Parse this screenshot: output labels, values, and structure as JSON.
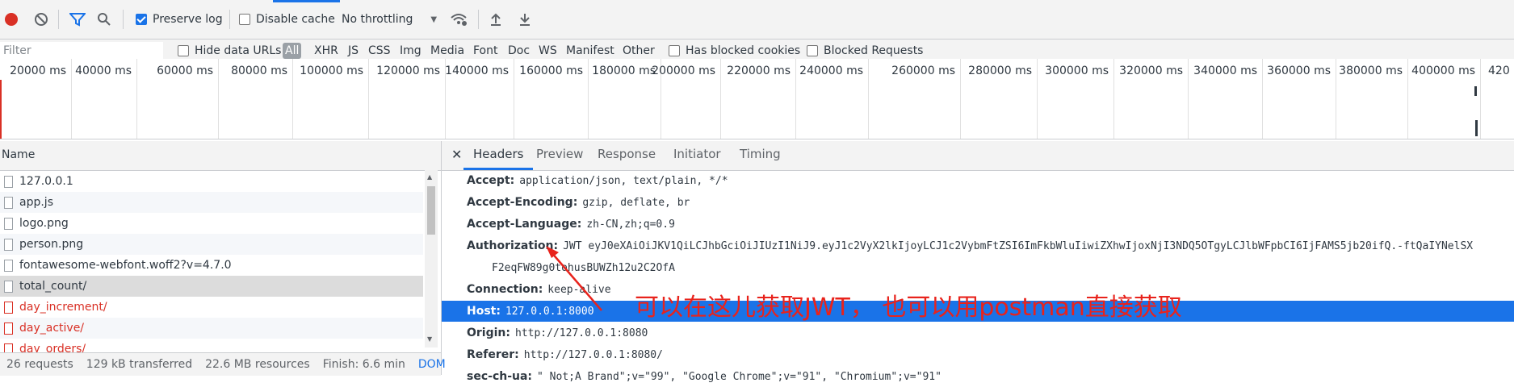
{
  "toolbar": {
    "preserve_log_label": "Preserve log",
    "preserve_log_checked": true,
    "disable_cache_label": "Disable cache",
    "disable_cache_checked": false,
    "throttling_value": "No throttling",
    "icons": [
      "record-icon",
      "clear-icon",
      "filter-icon",
      "search-icon",
      "chevron-down-icon",
      "network-conditions-icon",
      "import-icon",
      "export-icon"
    ],
    "record_color": "#d93025",
    "filter_color": "#1a73e8"
  },
  "filterbar": {
    "filter_placeholder": "Filter",
    "hide_data_urls_label": "Hide data URLs",
    "types": [
      "All",
      "XHR",
      "JS",
      "CSS",
      "Img",
      "Media",
      "Font",
      "Doc",
      "WS",
      "Manifest",
      "Other"
    ],
    "has_blocked_cookies_label": "Has blocked cookies",
    "blocked_requests_label": "Blocked Requests"
  },
  "overview": {
    "ticks": [
      "20000 ms",
      "40000 ms",
      "60000 ms",
      "80000 ms",
      "100000 ms",
      "120000 ms",
      "140000 ms",
      "160000 ms",
      "180000 ms",
      "200000 ms",
      "220000 ms",
      "240000 ms",
      "260000 ms",
      "280000 ms",
      "300000 ms",
      "320000 ms",
      "340000 ms",
      "360000 ms",
      "380000 ms",
      "400000 ms",
      "420"
    ]
  },
  "requests": {
    "header": "Name",
    "items": [
      {
        "name": "127.0.0.1",
        "error": false
      },
      {
        "name": "app.js",
        "error": false
      },
      {
        "name": "logo.png",
        "error": false
      },
      {
        "name": "person.png",
        "error": false
      },
      {
        "name": "fontawesome-webfont.woff2?v=4.7.0",
        "error": false
      },
      {
        "name": "total_count/",
        "error": false
      },
      {
        "name": "day_increment/",
        "error": true
      },
      {
        "name": "day_active/",
        "error": true
      },
      {
        "name": "day_orders/",
        "error": true
      }
    ]
  },
  "statusbar": {
    "requests": "26 requests",
    "transferred": "129 kB transferred",
    "resources": "22.6 MB resources",
    "finish": "Finish: 6.6 min",
    "dom": "DOM"
  },
  "details": {
    "tabs": [
      "Headers",
      "Preview",
      "Response",
      "Initiator",
      "Timing"
    ],
    "active_tab": "Headers",
    "headers": [
      {
        "key": "Accept:",
        "value": "application/json, text/plain, */*"
      },
      {
        "key": "Accept-Encoding:",
        "value": "gzip, deflate, br"
      },
      {
        "key": "Accept-Language:",
        "value": "zh-CN,zh;q=0.9"
      },
      {
        "key": "Authorization:",
        "value": "JWT eyJ0eXAiOiJKV1QiLCJhbGciOiJIUzI1NiJ9.eyJ1c2VyX2lkIjoyLCJ1c2VybmFtZSI6ImFkbWluIiwiZXhwIjoxNjI3NDQ5OTgyLCJlbWFpbCI6IjFAMS5jb20ifQ.-ftQaIYNelSX"
      },
      {
        "key": "",
        "value": "F2eqFW89g0tohusBUWZh12u2C2OfA"
      },
      {
        "key": "Connection:",
        "value": "keep-alive"
      },
      {
        "key": "Host:",
        "value": "127.0.0.1:8000"
      },
      {
        "key": "Origin:",
        "value": "http://127.0.0.1:8080"
      },
      {
        "key": "Referer:",
        "value": "http://127.0.0.1:8080/"
      },
      {
        "key": "sec-ch-ua:",
        "value": "\" Not;A Brand\";v=\"99\", \"Google Chrome\";v=\"91\", \"Chromium\";v=\"91\""
      }
    ],
    "selected_header": "Host:"
  },
  "annotation": {
    "text": "可以在这儿获取JWT， 也可以用postman直接获取",
    "color": "#e8231c"
  }
}
